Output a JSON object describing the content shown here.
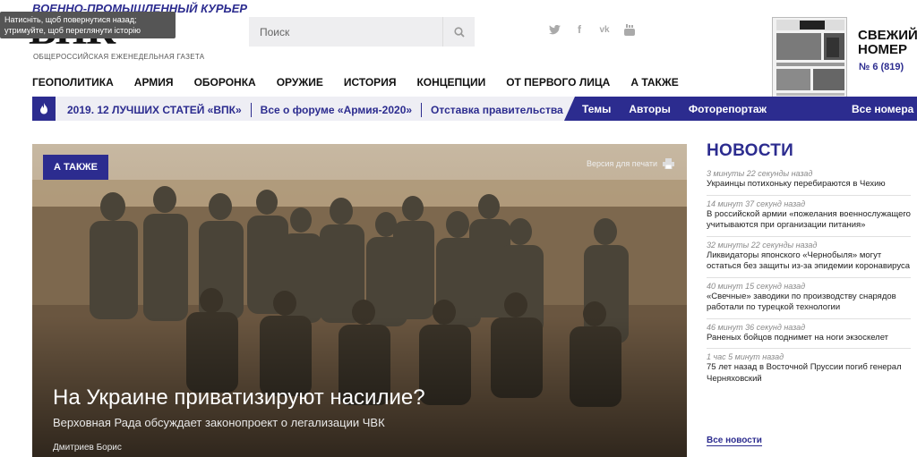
{
  "header": {
    "logo_top": "ВОЕННО-ПРОМЫШЛЕННЫЙ КУРЬЕР",
    "logo_main": "ВПК",
    "logo_sub": "ОБЩЕРОССИЙСКАЯ ЕЖЕНЕДЕЛЬНАЯ ГАЗЕТА",
    "tooltip": "Натисніть, щоб повернутися назад;\nутримуйте, щоб переглянути історію",
    "search_placeholder": "Поиск",
    "socials": [
      "twitter-icon",
      "facebook-icon",
      "vk-icon",
      "youtube-icon"
    ],
    "issue_title": "СВЕЖИЙ\nНОМЕР",
    "issue_number": "№ 6 (819)"
  },
  "nav": [
    "ГЕОПОЛИТИКА",
    "АРМИЯ",
    "ОБОРОНКА",
    "ОРУЖИЕ",
    "ИСТОРИЯ",
    "КОНЦЕПЦИИ",
    "ОТ ПЕРВОГО ЛИЦА",
    "А ТАКЖЕ"
  ],
  "bar": {
    "links": [
      "2019. 12 ЛУЧШИХ СТАТЕЙ «ВПК»",
      "Все о форуме «Армия-2020»",
      "Отставка правительства"
    ],
    "right_links": [
      "Темы",
      "Авторы",
      "Фоторепортаж",
      "Все номера"
    ]
  },
  "hero": {
    "tag": "А ТАКЖЕ",
    "print": "Версия для печати",
    "title": "На Украине приватизируют насилие?",
    "subtitle": "Верховная Рада обсуждает законопроект о легализации ЧВК",
    "author": "Дмитриев Борис"
  },
  "news": {
    "heading": "НОВОСТИ",
    "items": [
      {
        "time": "3 минуты 22 секунды назад",
        "text": "Украинцы потихоньку перебираются в Чехию"
      },
      {
        "time": "14 минут 37 секунд назад",
        "text": "В российской армии «пожелания военнослужащего учитываются при организации питания»"
      },
      {
        "time": "32 минуты 22 секунды назад",
        "text": "Ликвидаторы японского «Чернобыля» могут остаться без защиты из-за эпидемии коронавируса"
      },
      {
        "time": "40 минут 15 секунд назад",
        "text": "«Свечные» заводики по производству снарядов работали по турецкой технологии"
      },
      {
        "time": "46 минут 36 секунд назад",
        "text": "Раненых бойцов поднимет на ноги экзоскелет"
      },
      {
        "time": "1 час 5 минут назад",
        "text": "75 лет назад в Восточной Пруссии погиб генерал Черняховский"
      }
    ],
    "all": "Все новости"
  },
  "colors": {
    "brand": "#2c2c8f"
  }
}
